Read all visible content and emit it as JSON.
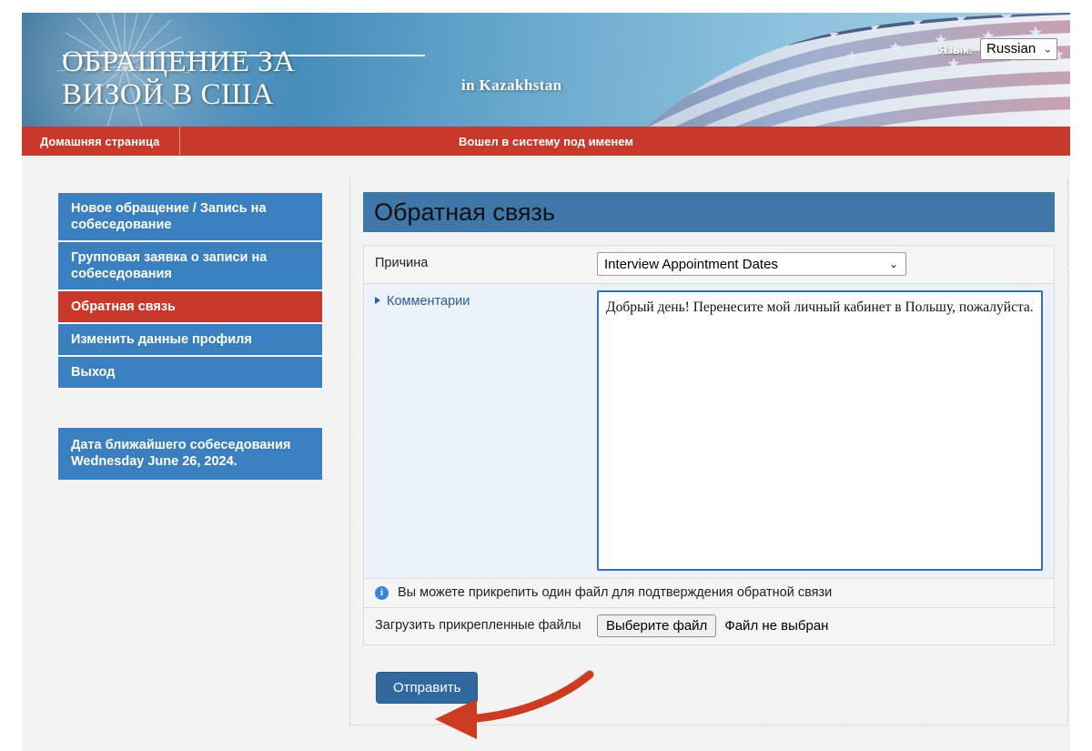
{
  "banner": {
    "title": "ОБРАЩЕНИЕ ЗА\nВИЗОЙ В США",
    "subtitle": "in  Kazakhstan",
    "language_label": "Язык:",
    "language_value": "Russian",
    "chevron": "⌄"
  },
  "navbar": {
    "home": "Домашняя страница",
    "logged_in": "Вошел в систему под именем"
  },
  "sidebar": {
    "items": [
      {
        "label": "Новое обращение / Запись на собеседование",
        "active": false
      },
      {
        "label": "Групповая заявка о записи на собеседования",
        "active": false
      },
      {
        "label": "Обратная связь",
        "active": true
      },
      {
        "label": "Изменить данные профиля",
        "active": false
      },
      {
        "label": "Выход",
        "active": false
      }
    ],
    "note": "Дата ближайшего собеседования Wednesday June 26, 2024."
  },
  "panel": {
    "heading": "Обратная связь",
    "reason_label": "Причина",
    "reason_value": "Interview Appointment Dates",
    "reason_chevron": "⌄",
    "comments_label": "Комментарии",
    "comments_value": "Добрый день! Перенесите мой личный кабинет в Польшу, пожалуйста.",
    "comments_placeholder": "",
    "info_icon_glyph": "i",
    "info_text": "Вы можете прикрепить один файл для подтверждения обратной связи",
    "upload_label": "Загрузить прикрепленные файлы",
    "file_button": "Выберите файл",
    "file_status": "Файл не выбран",
    "submit_label": "Отправить"
  },
  "colors": {
    "brand_red": "#c8392b",
    "brand_blue": "#3a80c1",
    "panel_header_blue": "#3e77a8",
    "submit_blue": "#31689e",
    "arrow_red": "#cc3c22",
    "info_blue": "#3b82e0"
  }
}
